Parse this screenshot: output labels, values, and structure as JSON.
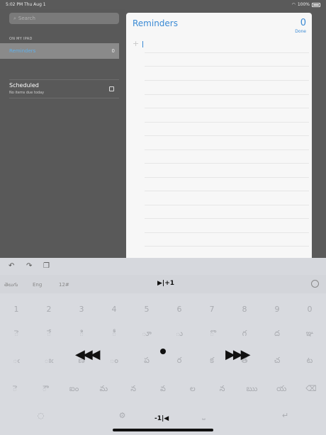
{
  "status": {
    "time": "5:02 PM",
    "date": "Thu Aug 1",
    "battery": "100%"
  },
  "sidebar": {
    "search_placeholder": "Search",
    "section_header": "ON MY IPAD",
    "lists": [
      {
        "name": "Reminders",
        "count": "0"
      }
    ],
    "scheduled": {
      "title": "Scheduled",
      "subtitle": "No items due today"
    }
  },
  "panel": {
    "title": "Reminders",
    "count": "0",
    "done_label": "Done"
  },
  "keyboard": {
    "languages": [
      "తెలుగు",
      "Eng",
      "12#"
    ],
    "cursor_hint_top": "▶|+1",
    "cursor_hint_bottom": "-1|◀",
    "row1": [
      "1",
      "2",
      "3",
      "4",
      "5",
      "6",
      "7",
      "8",
      "9",
      "0"
    ],
    "row2": [
      "ె",
      "ే",
      "ి",
      "ీ",
      "ూ",
      "ు",
      "ొ",
      "గ",
      "ద",
      "ఞ"
    ],
    "row3": [
      "ఁ",
      "ఃఁ",
      "ణ",
      "ం",
      "ప",
      "ర",
      "క",
      "త",
      "చ",
      "ట"
    ],
    "row4": [
      "ె",
      "ౌ",
      "ఐం",
      "మ",
      "న",
      "వ",
      "ల",
      "న",
      "ఋ",
      "య"
    ],
    "overlay_left": "◀◀◀",
    "overlay_right": "▶▶▶"
  }
}
